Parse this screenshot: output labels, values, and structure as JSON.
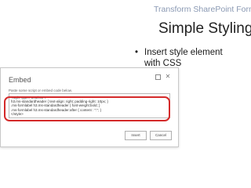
{
  "slide": {
    "header": "Transform SharePoint Forms",
    "title": "Simple Styling",
    "bullet_glyph": "•",
    "bullet_text": "Insert style element with CSS"
  },
  "dialog": {
    "title": "Embed",
    "restore_icon": "restore-window-icon",
    "close_icon": "close-icon",
    "close_glyph": "✕",
    "instruction": "Paste some script or embed code below.",
    "code_lines": [
      "<style type=\"text/css\">",
      "  h3.ms-standardheader { text-align: right; padding-right: 10px; }",
      "  .ms-formlabel h3.ms-standardheader { font-weight:bold; }",
      "  .ms-formlabel h3.ms-standardheader:after { content : \":\"; }",
      "</style>"
    ],
    "insert_label": "Insert",
    "cancel_label": "Cancel"
  },
  "colors": {
    "header": "#8a99b3",
    "highlight": "#d42a2a"
  }
}
